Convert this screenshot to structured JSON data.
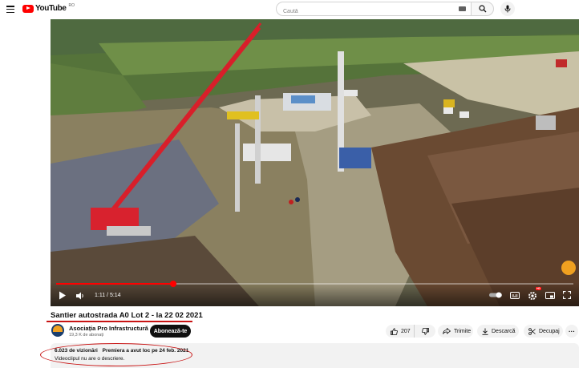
{
  "header": {
    "logo_text": "YouTube",
    "logo_region": "RO",
    "search_placeholder": "Caută",
    "icons": [
      "menu-icon",
      "keyboard-icon",
      "search-icon",
      "mic-icon"
    ]
  },
  "player": {
    "time": "1:11 / 5:14",
    "progress": 0.226,
    "icons": [
      "play-icon",
      "volume-icon",
      "autoplay-icon",
      "subtitles-icon",
      "settings-icon",
      "miniplayer-icon",
      "fullscreen-icon"
    ],
    "settings_badge": "HD"
  },
  "video": {
    "title": "Santier autostrada A0 Lot 2 - la 22 02 2021",
    "channel_name": "Asociația Pro Infrastructură",
    "subscribers": "19,3 K de abonați",
    "subscribe_label": "Abonează-te"
  },
  "actions": {
    "likes": "207",
    "share_label": "Trimite",
    "download_label": "Descarcă",
    "clip_label": "Decupaj",
    "more_label": "···"
  },
  "description": {
    "views": "6.023 de vizionări",
    "premiere": "Premiera a avut loc pe 24 feb. 2021",
    "text": "Videoclipul nu are o descriere."
  },
  "colors": {
    "brand_red": "#ff0000",
    "annotation_red": "#c81414"
  }
}
